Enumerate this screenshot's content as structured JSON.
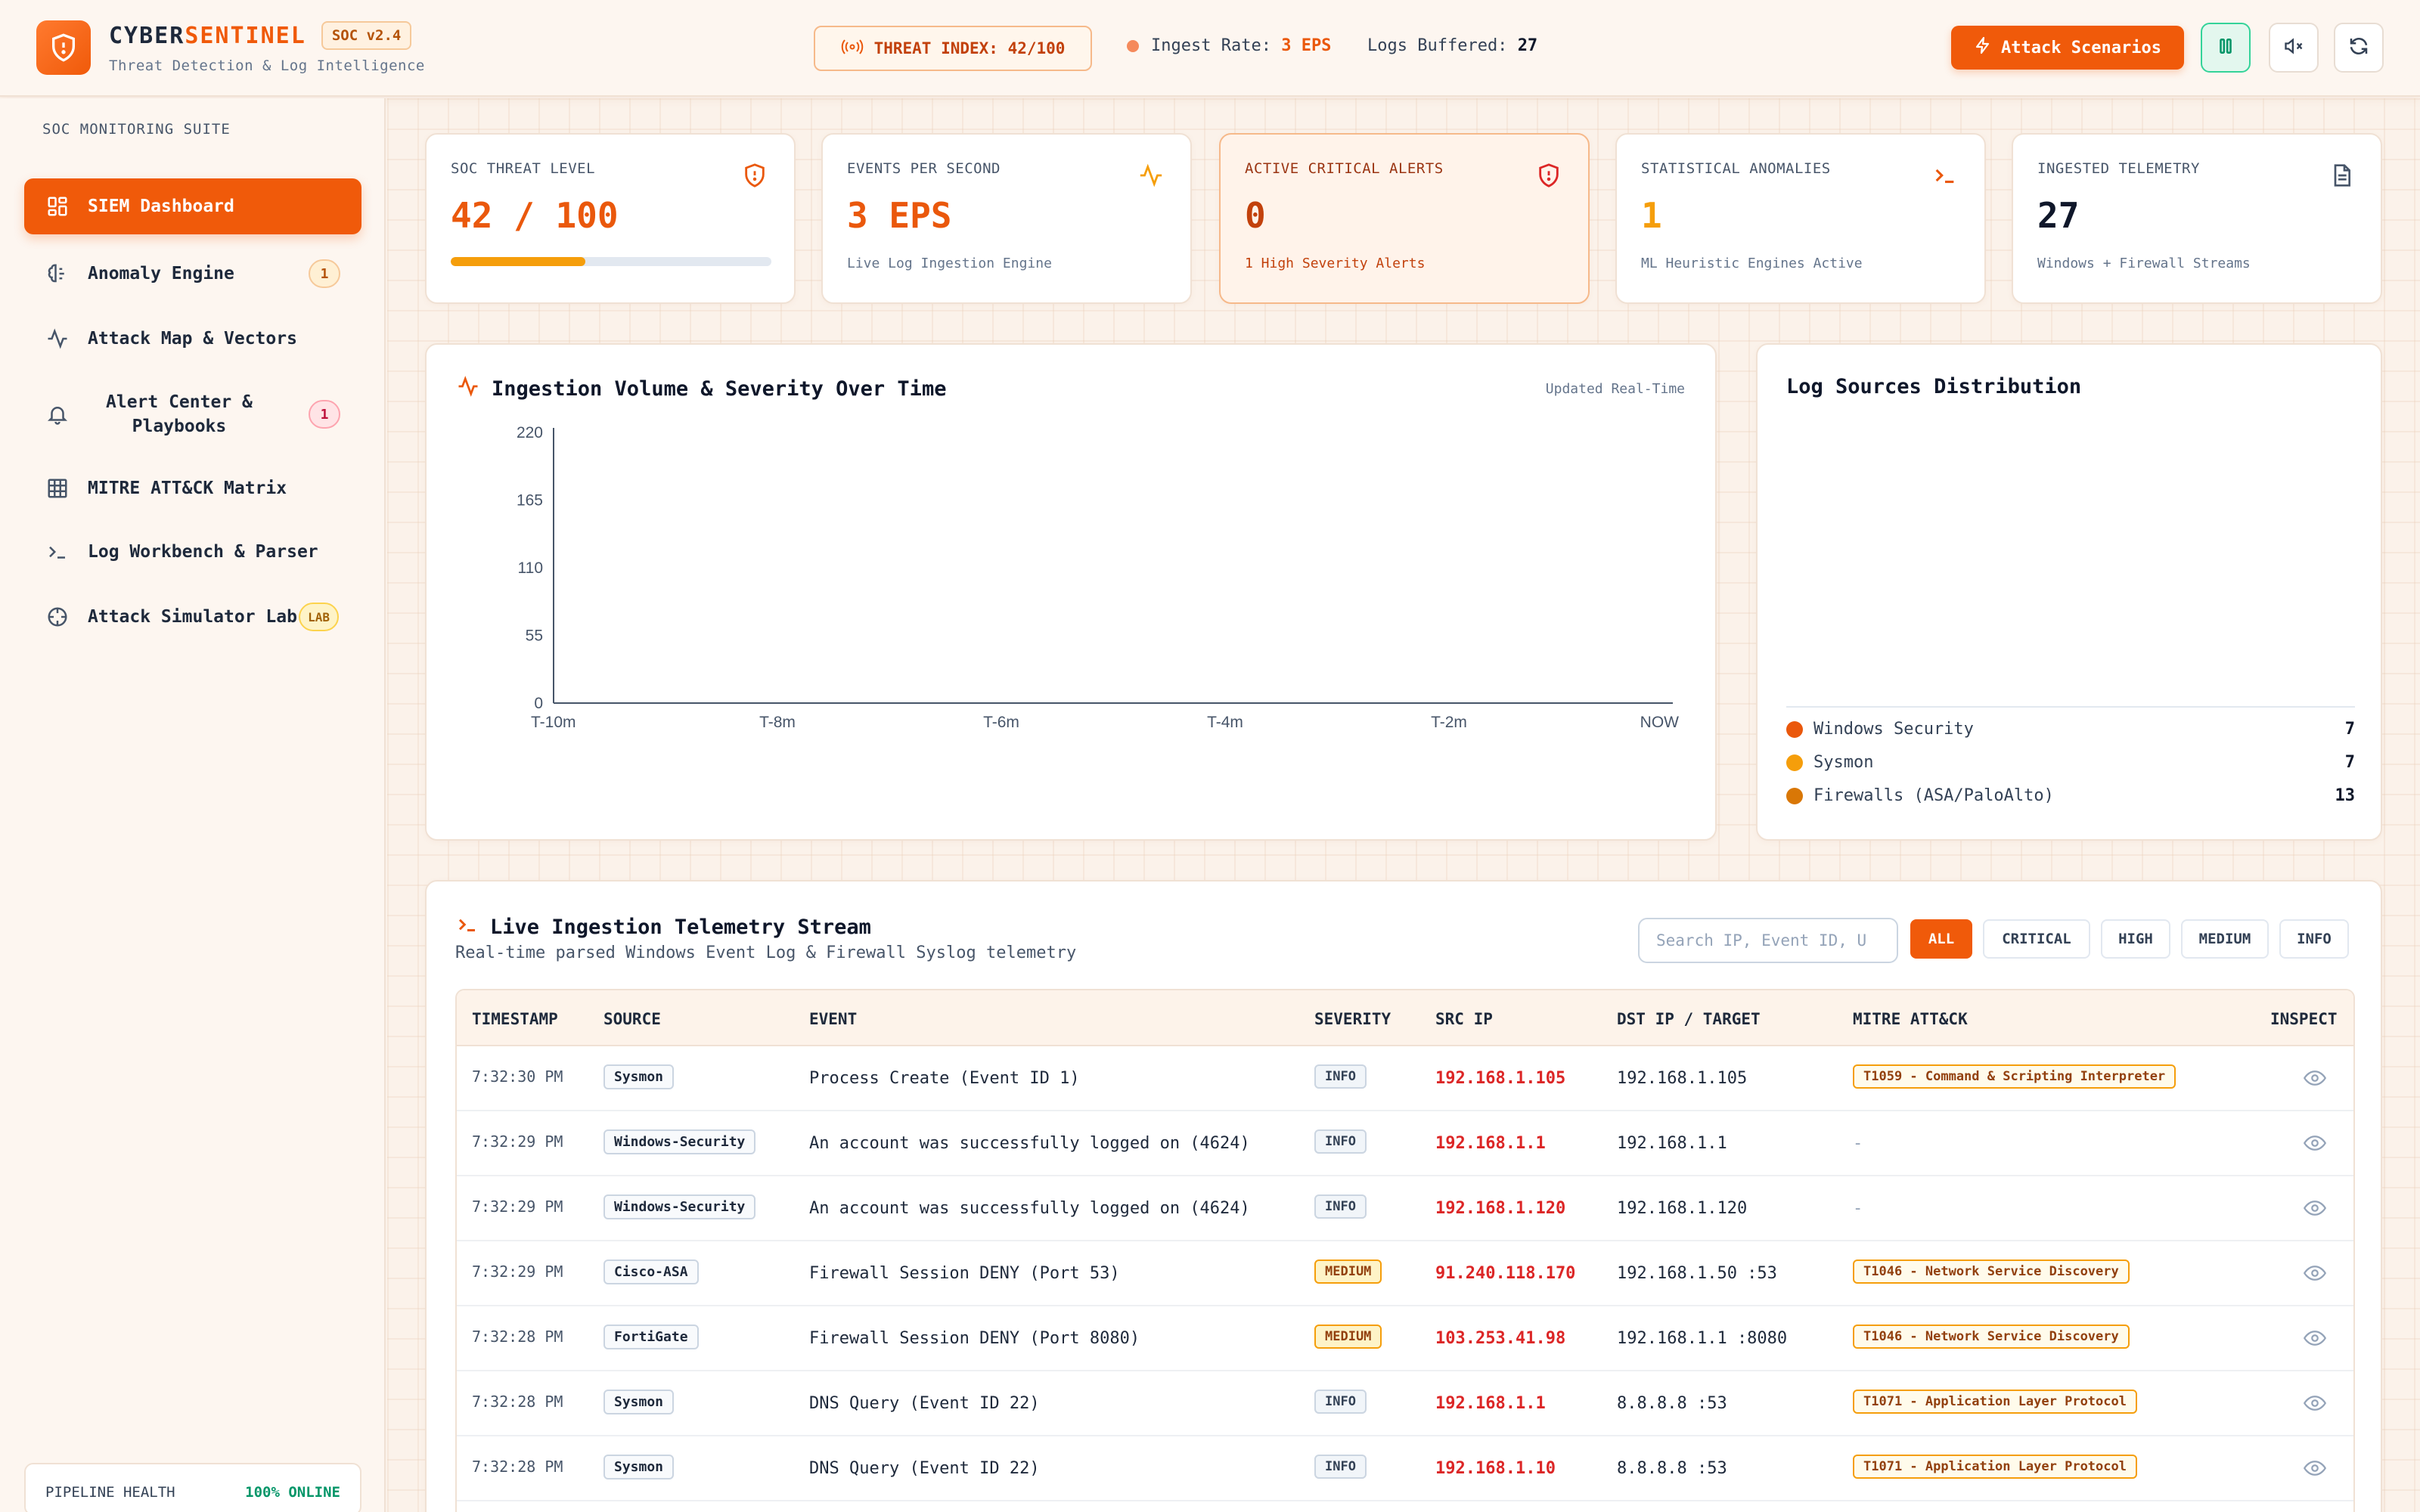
{
  "header": {
    "brand_prefix": "CYBER",
    "brand_accent": "SENTINEL",
    "version": "SOC v2.4",
    "subtitle": "Threat Detection & Log Intelligence",
    "threat_index": "THREAT INDEX: 42/100",
    "ingest_label": "Ingest Rate:",
    "ingest_value": "3 EPS",
    "buffered_label": "Logs Buffered:",
    "buffered_value": "27",
    "attack_button": "Attack Scenarios",
    "icons": [
      "shield-icon",
      "broadcast-icon",
      "zap-icon",
      "pause-icon",
      "mute-icon",
      "refresh-icon"
    ]
  },
  "sidebar": {
    "section": "SOC MONITORING SUITE",
    "items": [
      {
        "label": "SIEM Dashboard",
        "icon": "dashboard-icon",
        "badge": ""
      },
      {
        "label": "Anomaly Engine",
        "icon": "brain-icon",
        "badge": "1"
      },
      {
        "label": "Attack Map & Vectors",
        "icon": "activity-icon",
        "badge": ""
      },
      {
        "label": "Alert Center &",
        "label2": "Playbooks",
        "icon": "bell-icon",
        "badge": "1"
      },
      {
        "label": "MITRE ATT&CK Matrix",
        "icon": "grid-icon",
        "badge": ""
      },
      {
        "label": "Log Workbench & Parser",
        "icon": "terminal-icon",
        "badge": ""
      },
      {
        "label": "Attack Simulator Lab",
        "icon": "crosshair-icon",
        "badge": "LAB"
      }
    ],
    "pipeline_label": "PIPELINE HEALTH",
    "pipeline_status": "100% ONLINE"
  },
  "stats": [
    {
      "label": "SOC THREAT LEVEL",
      "value": "42 / 100",
      "progress": 0.42,
      "icon": "shield-alert-icon"
    },
    {
      "label": "EVENTS PER SECOND",
      "value": "3 EPS",
      "sub": "Live Log Ingestion Engine",
      "icon": "pulse-icon"
    },
    {
      "label": "ACTIVE CRITICAL ALERTS",
      "value": "0",
      "sub": "1 High Severity Alerts",
      "icon": "shield-alert-icon"
    },
    {
      "label": "STATISTICAL ANOMALIES",
      "value": "1",
      "sub": "ML Heuristic Engines Active",
      "icon": "terminal-icon"
    },
    {
      "label": "INGESTED TELEMETRY",
      "value": "27",
      "sub": "Windows + Firewall Streams",
      "icon": "file-icon"
    }
  ],
  "chart": {
    "title": "Ingestion Volume & Severity Over Time",
    "updated": "Updated Real-Time"
  },
  "chart_data": {
    "type": "area",
    "title": "Ingestion Volume & Severity Over Time",
    "x": [
      "T-10m",
      "T-8m",
      "T-6m",
      "T-4m",
      "T-2m",
      "NOW"
    ],
    "yticks": [
      0,
      55,
      110,
      165,
      220
    ],
    "ylim": [
      0,
      220
    ],
    "series": [],
    "grid": false
  },
  "distribution": {
    "title": "Log Sources Distribution",
    "items": [
      {
        "label": "Windows Security",
        "count": "7",
        "color": "#ea580c"
      },
      {
        "label": "Sysmon",
        "count": "7",
        "color": "#f59e0b"
      },
      {
        "label": "Firewalls (ASA/PaloAlto)",
        "count": "13",
        "color": "#d97706"
      }
    ]
  },
  "stream": {
    "title": "Live Ingestion Telemetry Stream",
    "subtitle": "Real-time parsed Windows Event Log & Firewall Syslog telemetry",
    "search_placeholder": "Search IP, Event ID, U",
    "filters": [
      "ALL",
      "CRITICAL",
      "HIGH",
      "MEDIUM",
      "INFO"
    ],
    "columns": [
      "TIMESTAMP",
      "SOURCE",
      "EVENT",
      "SEVERITY",
      "SRC IP",
      "DST IP / TARGET",
      "MITRE ATT&CK",
      "INSPECT"
    ],
    "rows": [
      {
        "time": "7:32:30 PM",
        "source": "Sysmon",
        "event": "Process Create (Event ID 1)",
        "severity": "INFO",
        "src": "192.168.1.105",
        "dst": "192.168.1.105",
        "mitre": "T1059 - Command & Scripting Interpreter"
      },
      {
        "time": "7:32:29 PM",
        "source": "Windows-Security",
        "event": "An account was successfully logged on (4624)",
        "severity": "INFO",
        "src": "192.168.1.1",
        "dst": "192.168.1.1",
        "mitre": "-"
      },
      {
        "time": "7:32:29 PM",
        "source": "Windows-Security",
        "event": "An account was successfully logged on (4624)",
        "severity": "INFO",
        "src": "192.168.1.120",
        "dst": "192.168.1.120",
        "mitre": "-"
      },
      {
        "time": "7:32:29 PM",
        "source": "Cisco-ASA",
        "event": "Firewall Session DENY (Port 53)",
        "severity": "MEDIUM",
        "src": "91.240.118.170",
        "dst": "192.168.1.50 :53",
        "mitre": "T1046 - Network Service Discovery"
      },
      {
        "time": "7:32:28 PM",
        "source": "FortiGate",
        "event": "Firewall Session DENY (Port 8080)",
        "severity": "MEDIUM",
        "src": "103.253.41.98",
        "dst": "192.168.1.1 :8080",
        "mitre": "T1046 - Network Service Discovery"
      },
      {
        "time": "7:32:28 PM",
        "source": "Sysmon",
        "event": "DNS Query (Event ID 22)",
        "severity": "INFO",
        "src": "192.168.1.1",
        "dst": "8.8.8.8 :53",
        "mitre": "T1071 - Application Layer Protocol"
      },
      {
        "time": "7:32:28 PM",
        "source": "Sysmon",
        "event": "DNS Query (Event ID 22)",
        "severity": "INFO",
        "src": "192.168.1.10",
        "dst": "8.8.8.8 :53",
        "mitre": "T1071 - Application Layer Protocol"
      }
    ]
  }
}
